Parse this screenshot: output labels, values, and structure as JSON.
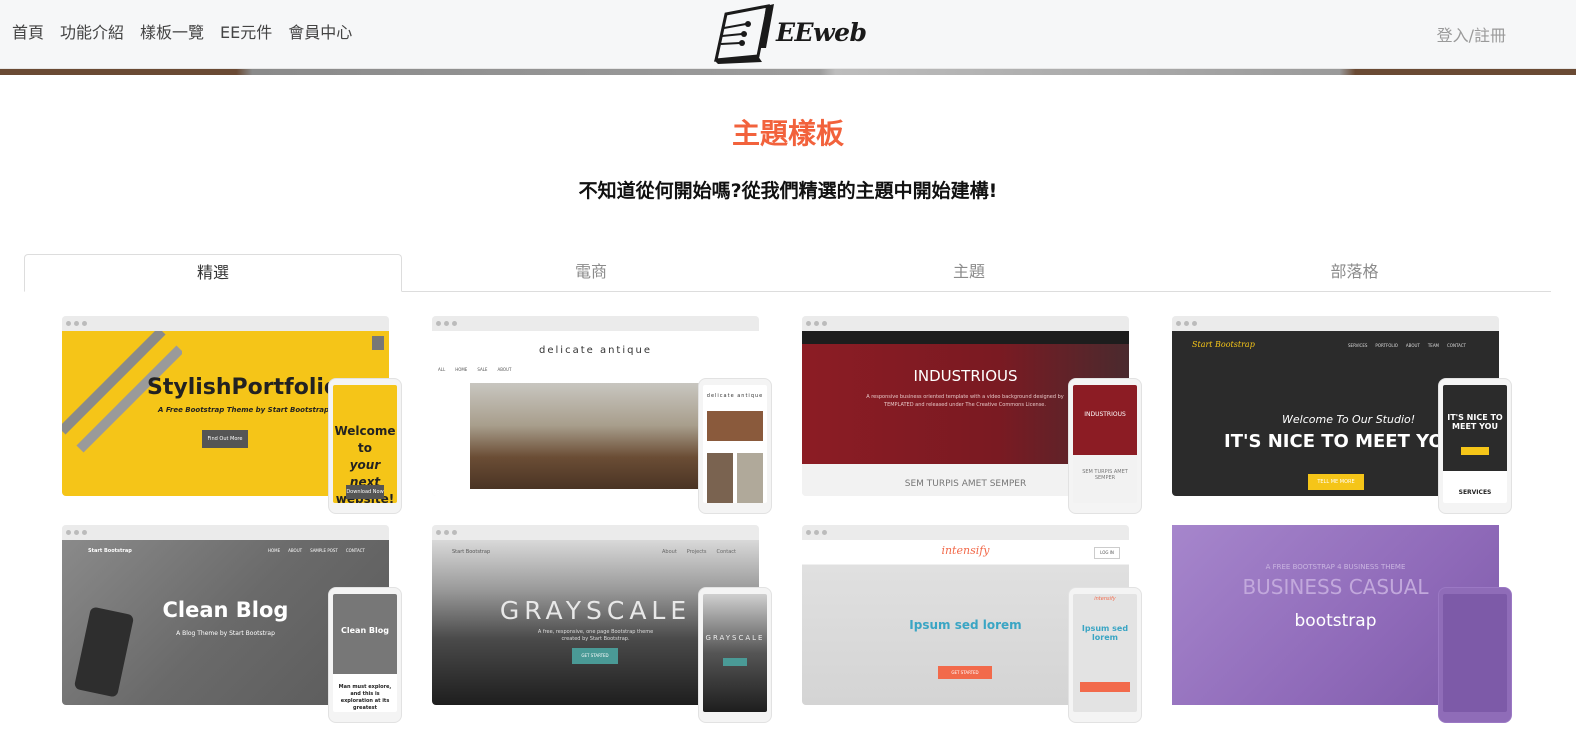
{
  "nav": {
    "items": [
      "首頁",
      "功能介紹",
      "樣板一覽",
      "EE元件",
      "會員中心"
    ],
    "logo_text": "EEweb",
    "login": "登入/註冊"
  },
  "hero": {
    "title": "主題樣板",
    "subtitle": "不知道從何開始嗎?從我們精選的主題中開始建構!"
  },
  "tabs": [
    "精選",
    "電商",
    "主題",
    "部落格"
  ],
  "active_tab": "精選",
  "templates": [
    {
      "name": "StylishPortfolio",
      "tagline": "A Free Bootstrap Theme by Start Bootstrap",
      "button": "Find Out More",
      "phone_text": [
        "Welcome to",
        "your next",
        "website!"
      ],
      "phone_button": "Download Now",
      "color": "#f5c518"
    },
    {
      "name": "delicate antique",
      "nav": [
        "ALL",
        "HOME",
        "SALE",
        "ABOUT"
      ],
      "color": "#ffffff"
    },
    {
      "name": "INDUSTRIOUS",
      "tagline": "A responsive business oriented template with a video background designed by TEMPLATED and released under The Creative Commons License.",
      "caption": "SEM TURPIS AMET SEMPER",
      "phone_caption": "SEM TURPIS AMET SEMPER",
      "color": "#8c1c24"
    },
    {
      "name": "Start Bootstrap",
      "nav": [
        "SERVICES",
        "PORTFOLIO",
        "ABOUT",
        "TEAM",
        "CONTACT"
      ],
      "subtitle": "Welcome To Our Studio!",
      "title": "IT'S NICE TO MEET YOU",
      "button": "TELL ME MORE",
      "phone_title": "IT'S NICE TO MEET YOU",
      "phone_caption": "SERVICES",
      "color": "#2b2b2b"
    },
    {
      "name": "Clean Blog",
      "tagline": "A Blog Theme by Start Bootstrap",
      "brand": "Start Bootstrap",
      "nav": [
        "HOME",
        "ABOUT",
        "SAMPLE POST",
        "CONTACT"
      ],
      "phone_text": "Man must explore, and this is exploration at its greatest",
      "color": "#6d6d6d"
    },
    {
      "name": "GRAYSCALE",
      "tagline": "A free, responsive, one page Bootstrap theme created by Start Bootstrap.",
      "button": "GET STARTED",
      "nav": [
        "About",
        "Projects",
        "Contact"
      ],
      "brand": "Start Bootstrap",
      "color": "#3a3a3a"
    },
    {
      "name": "intensify",
      "title": "Ipsum sed lorem",
      "button": "GET STARTED",
      "login": "LOG IN",
      "phone_title": "Ipsum sed lorem",
      "color": "#e9e9e9"
    },
    {
      "name": "bootstrap",
      "over": "A FREE BOOTSTRAP 4 BUSINESS THEME",
      "title": "BUSINESS CASUAL",
      "color": "#9b78c4"
    }
  ]
}
